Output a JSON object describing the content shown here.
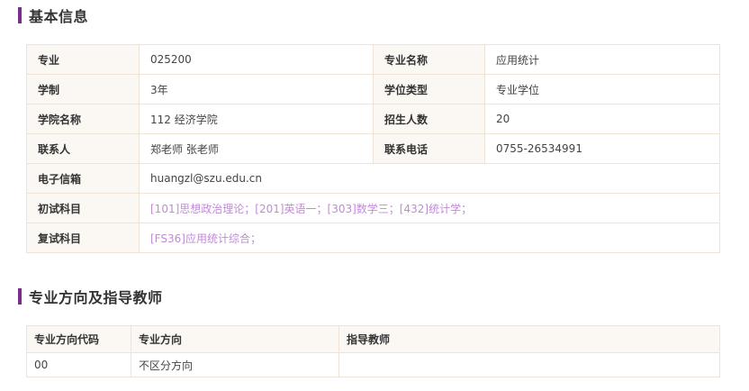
{
  "basic_info": {
    "title": "基本信息",
    "rows": [
      {
        "label1": "专业",
        "value1": "025200",
        "label2": "专业名称",
        "value2": "应用统计"
      },
      {
        "label1": "学制",
        "value1": "3年",
        "label2": "学位类型",
        "value2": "专业学位"
      },
      {
        "label1": "学院名称",
        "value1": "112 经济学院",
        "label2": "招生人数",
        "value2": "20"
      },
      {
        "label1": "联系人",
        "value1": "郑老师 张老师",
        "label2": "联系电话",
        "value2": "0755-26534991"
      }
    ],
    "email_label": "电子信箱",
    "email_value": "huangzl@szu.edu.cn",
    "initial_subjects_label": "初试科目",
    "initial_subjects_value": "[101]思想政治理论；[201]英语一；[303]数学三；[432]统计学；",
    "retest_subjects_label": "复试科目",
    "retest_subjects_value": "[FS36]应用统计综合；"
  },
  "direction": {
    "title": "专业方向及指导教师",
    "headers": [
      "专业方向代码",
      "专业方向",
      "指导教师"
    ],
    "rows": [
      {
        "code": "00",
        "name": "不区分方向",
        "supervisor": ""
      }
    ]
  },
  "colors": {
    "accent_bar": "#7b2d8e",
    "subject_link": "#c08ad6",
    "label_bg": "#fbf8f4",
    "border": "#efe3d6"
  }
}
